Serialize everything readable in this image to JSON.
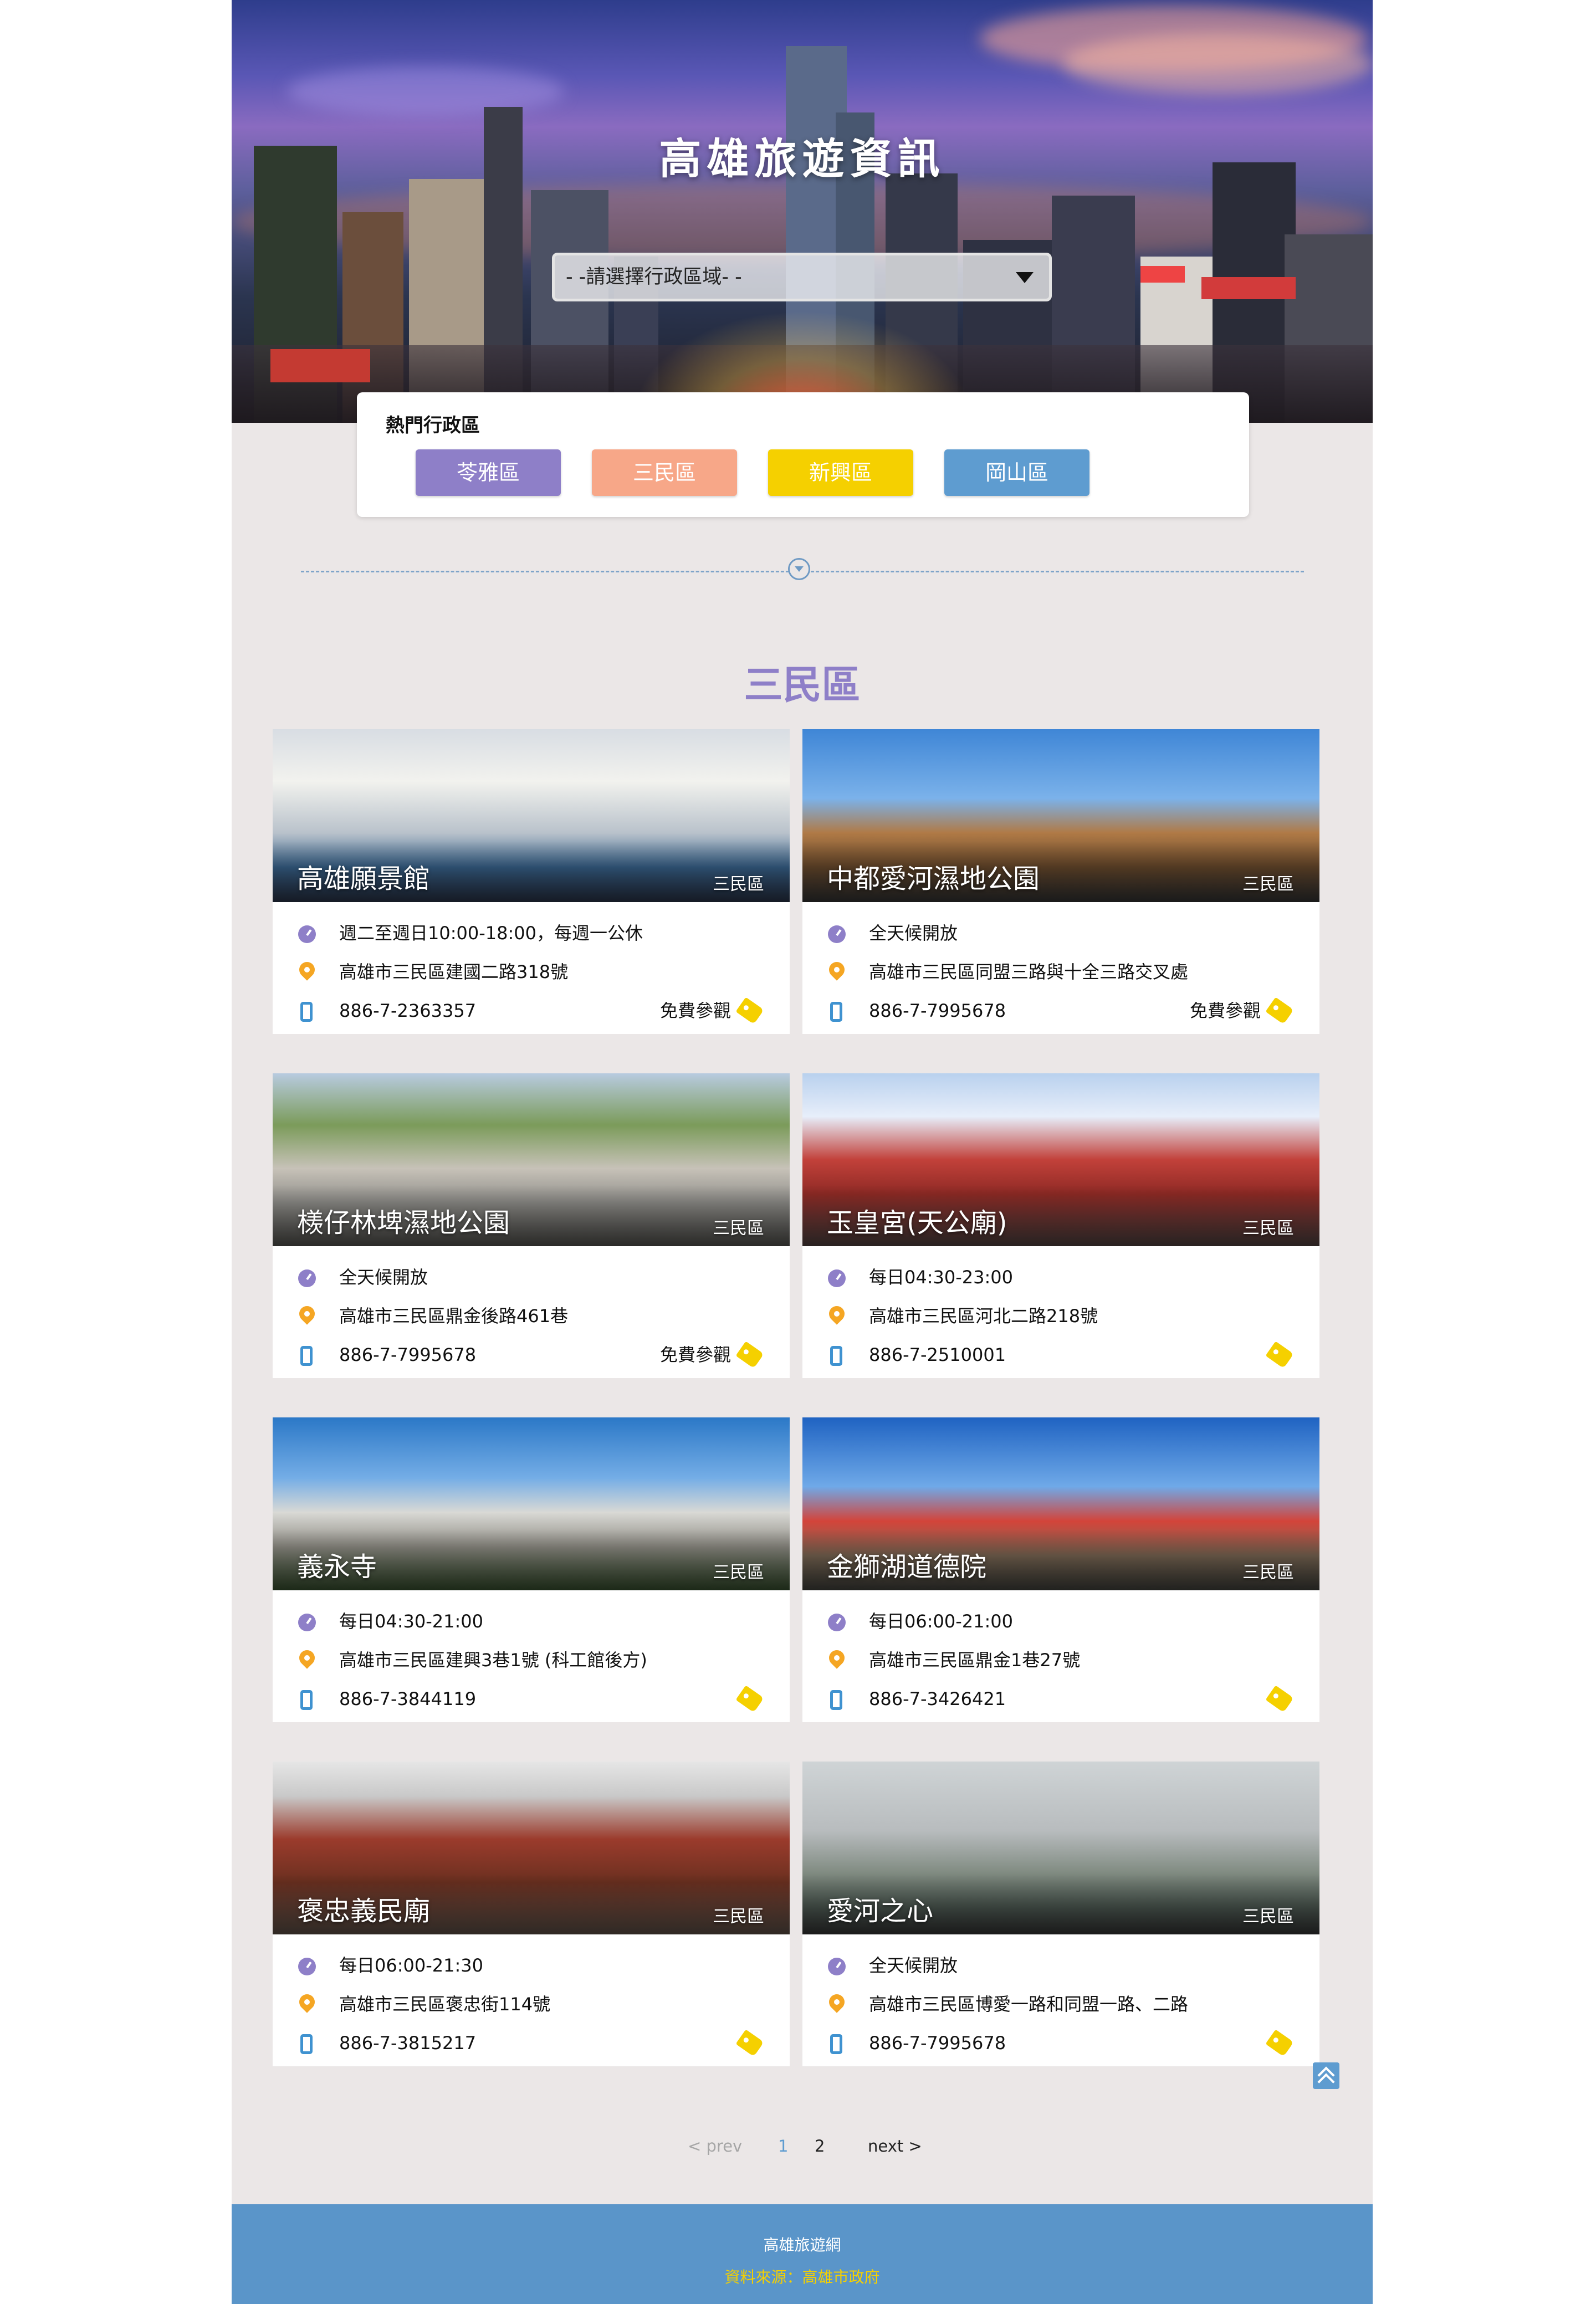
{
  "hero": {
    "title": "高雄旅遊資訊",
    "select_value": "- -請選擇行政區域- -"
  },
  "hot_districts": {
    "title": "熱門行政區",
    "buttons": [
      {
        "label": "苓雅區",
        "color": "#8e7fc8"
      },
      {
        "label": "三民區",
        "color": "#f7a788"
      },
      {
        "label": "新興區",
        "color": "#f5d000"
      },
      {
        "label": "岡山區",
        "color": "#5e9cd0"
      }
    ]
  },
  "section": {
    "title": "三民區"
  },
  "cards": [
    {
      "name": "高雄願景館",
      "zone": "三民區",
      "hours": "週二至週日10:00-18:00，每週一公休",
      "address": "高雄市三民區建國二路318號",
      "phone": "886-7-2363357",
      "ticket": "免費參觀"
    },
    {
      "name": "中都愛河濕地公園",
      "zone": "三民區",
      "hours": "全天候開放",
      "address": "高雄市三民區同盟三路與十全三路交叉處",
      "phone": "886-7-7995678",
      "ticket": "免費參觀"
    },
    {
      "name": "檨仔林埤濕地公園",
      "zone": "三民區",
      "hours": "全天候開放",
      "address": "高雄市三民區鼎金後路461巷",
      "phone": "886-7-7995678",
      "ticket": "免費參觀"
    },
    {
      "name": "玉皇宮(天公廟)",
      "zone": "三民區",
      "hours": "每日04:30-23:00",
      "address": "高雄市三民區河北二路218號",
      "phone": "886-7-2510001",
      "ticket": ""
    },
    {
      "name": "義永寺",
      "zone": "三民區",
      "hours": "每日04:30-21:00",
      "address": "高雄市三民區建興3巷1號 (科工館後方)",
      "phone": "886-7-3844119",
      "ticket": ""
    },
    {
      "name": "金獅湖道德院",
      "zone": "三民區",
      "hours": "每日06:00-21:00",
      "address": "高雄市三民區鼎金1巷27號",
      "phone": "886-7-3426421",
      "ticket": ""
    },
    {
      "name": "褒忠義民廟",
      "zone": "三民區",
      "hours": "每日06:00-21:30",
      "address": "高雄市三民區褒忠街114號",
      "phone": "886-7-3815217",
      "ticket": ""
    },
    {
      "name": "愛河之心",
      "zone": "三民區",
      "hours": "全天候開放",
      "address": "高雄市三民區博愛一路和同盟一路、二路",
      "phone": "886-7-7995678",
      "ticket": ""
    }
  ],
  "pagination": {
    "prev": "< prev",
    "pages": [
      "1",
      "2"
    ],
    "current": "1",
    "next": "next >"
  },
  "footer": {
    "title": "高雄旅遊網",
    "source": "資料來源：高雄市政府"
  }
}
